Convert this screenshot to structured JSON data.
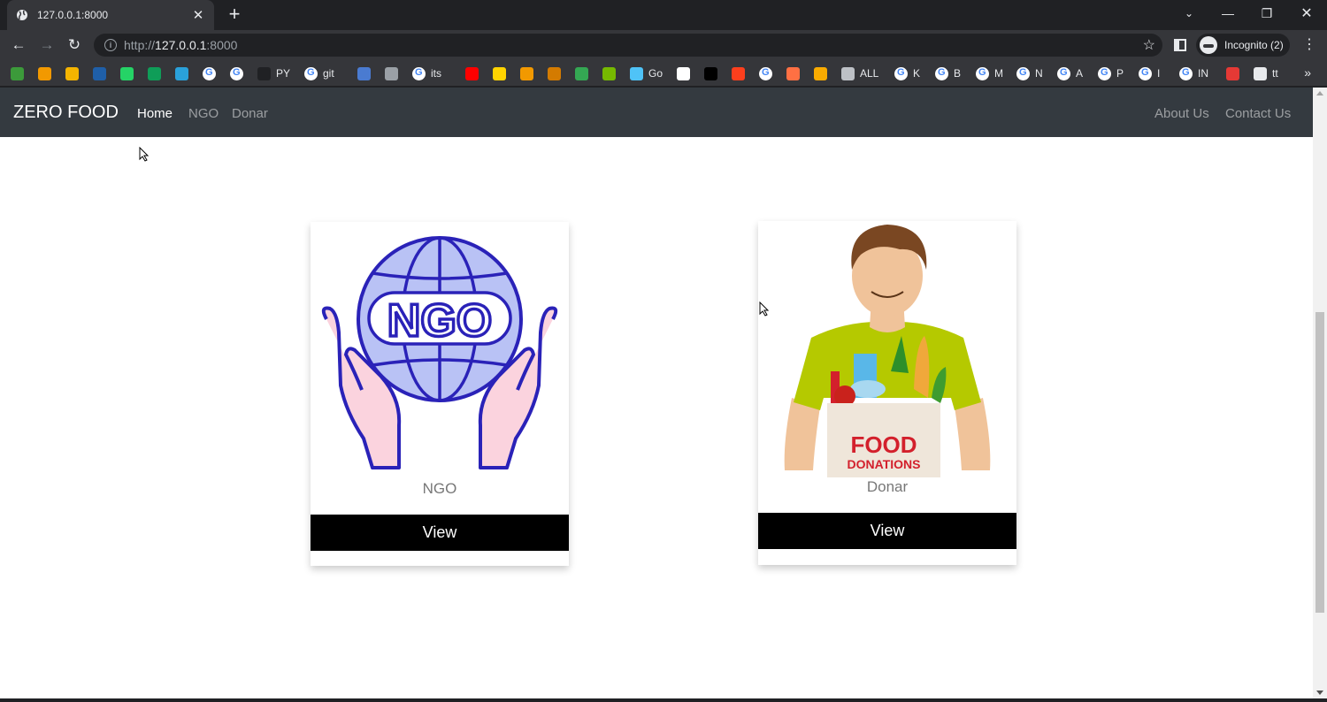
{
  "browser": {
    "tab_title": "127.0.0.1:8000",
    "new_tab_label": "+",
    "url_scheme": "http://",
    "url_host": "127.0.0.1",
    "url_port": ":8000",
    "profile_label": "Incognito (2)",
    "bookmarks": [
      {
        "icon": "green-icon",
        "label": ""
      },
      {
        "icon": "orange-icon",
        "label": ""
      },
      {
        "icon": "bar-chart-icon",
        "label": ""
      },
      {
        "icon": "ieee-icon",
        "label": ""
      },
      {
        "icon": "whatsapp-icon",
        "label": ""
      },
      {
        "icon": "green-plus-icon",
        "label": ""
      },
      {
        "icon": "telegram-icon",
        "label": ""
      },
      {
        "icon": "google-icon",
        "label": ""
      },
      {
        "icon": "google-icon",
        "label": ""
      },
      {
        "icon": "github-icon",
        "label": "PY"
      },
      {
        "icon": "google-icon",
        "label": "git"
      },
      {
        "icon": "grid-icon",
        "label": ""
      },
      {
        "icon": "car-icon",
        "label": ""
      },
      {
        "icon": "google-icon",
        "label": "its"
      },
      {
        "icon": "youtube-icon",
        "label": ""
      },
      {
        "icon": "p-icon",
        "label": ""
      },
      {
        "icon": "robot-icon",
        "label": ""
      },
      {
        "icon": "cart-icon",
        "label": ""
      },
      {
        "icon": "circle-icon",
        "label": ""
      },
      {
        "icon": "nvidia-icon",
        "label": ""
      },
      {
        "icon": "swirl-icon",
        "label": "Go"
      },
      {
        "icon": "doc-icon",
        "label": ""
      },
      {
        "icon": "cl-icon",
        "label": ""
      },
      {
        "icon": "yandex-icon",
        "label": ""
      },
      {
        "icon": "google-icon",
        "label": ""
      },
      {
        "icon": "arrow-icon",
        "label": ""
      },
      {
        "icon": "box-icon",
        "label": ""
      },
      {
        "icon": "globe-icon",
        "label": "ALL"
      },
      {
        "icon": "google-icon",
        "label": "K"
      },
      {
        "icon": "google-icon",
        "label": "B"
      },
      {
        "icon": "google-icon",
        "label": "M"
      },
      {
        "icon": "google-icon",
        "label": "N"
      },
      {
        "icon": "google-icon",
        "label": "A"
      },
      {
        "icon": "google-icon",
        "label": "P"
      },
      {
        "icon": "google-icon",
        "label": "I"
      },
      {
        "icon": "google-icon",
        "label": "IN"
      },
      {
        "icon": "pdf-icon",
        "label": ""
      },
      {
        "icon": "monitor-icon",
        "label": "tt"
      }
    ],
    "more_bookmarks": "»"
  },
  "navbar": {
    "brand": "ZERO FOOD",
    "links": [
      "Home",
      "NGO",
      "Donar"
    ],
    "right_links": [
      "About Us",
      "Contact Us"
    ]
  },
  "cards": [
    {
      "caption": "NGO",
      "button": "View",
      "logo_text": "NGO"
    },
    {
      "caption": "Donar",
      "button": "View",
      "box_line1": "FOOD",
      "box_line2": "DONATIONS"
    }
  ],
  "colors": {
    "navbar_bg": "#343a40",
    "ngo_blue": "#2a22b8",
    "ngo_globe_fill": "#b9c2f5",
    "hand_pink": "#fbd3de",
    "donation_red": "#d3202c",
    "shirt_green": "#b5c900"
  }
}
